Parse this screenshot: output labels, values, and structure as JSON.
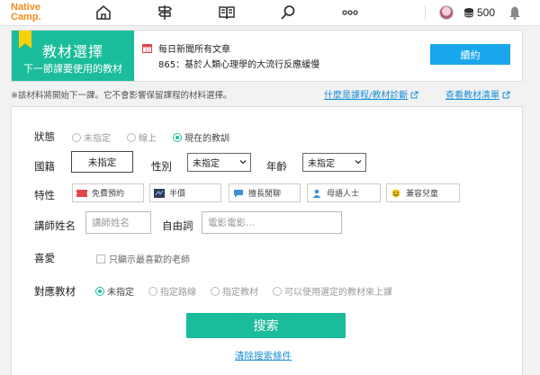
{
  "header": {
    "logo_line1": "Native",
    "logo_line2": "Camp.",
    "coins": "500",
    "nav_icons": [
      "home-icon",
      "signpost-icon",
      "book-icon",
      "search-icon",
      "more-icon"
    ]
  },
  "banner": {
    "title": "教材選擇",
    "subtitle": "下一節課要使用的教材",
    "news_title": "每日新聞所有文章",
    "news_lesson": "865：基於人類心理學的大流行反應緩慢",
    "continue_label": "續約"
  },
  "note": {
    "text": "※該材料將開始下一課。它不會影響保留課程的材料選擇。",
    "link_course_diag": "什麼是課程/教材診斷",
    "link_material_list": "查看教材清單"
  },
  "search": {
    "status_label": "狀態",
    "status_options": [
      "未指定",
      "線上",
      "現在的教訓"
    ],
    "status_selected": 2,
    "nationality_label": "國籍",
    "nationality_value": "未指定",
    "gender_label": "性別",
    "gender_value": "未指定",
    "age_label": "年齡",
    "age_value": "未指定",
    "feature_label": "特性",
    "features": [
      "免費預約",
      "半價",
      "擅長閒聊",
      "母語人士",
      "兼容兒童"
    ],
    "teacher_name_label": "講師姓名",
    "teacher_name_placeholder": "講師姓名",
    "free_word_label": "自由詞",
    "free_word_placeholder": "電影電影...",
    "favorite_label": "喜愛",
    "favorite_checkbox": "只顯示最喜歡的老師",
    "material_label": "對應教材",
    "material_options": [
      "未指定",
      "指定路線",
      "指定教材",
      "可以使用選定的教材來上課"
    ],
    "material_selected": 0,
    "search_button": "搜索",
    "clear_link": "清除搜索條件"
  },
  "colors": {
    "accent": "#1bbc9b",
    "brand": "#f28c1a",
    "link": "#1a8fd6",
    "button_blue": "#1aa6ec"
  }
}
